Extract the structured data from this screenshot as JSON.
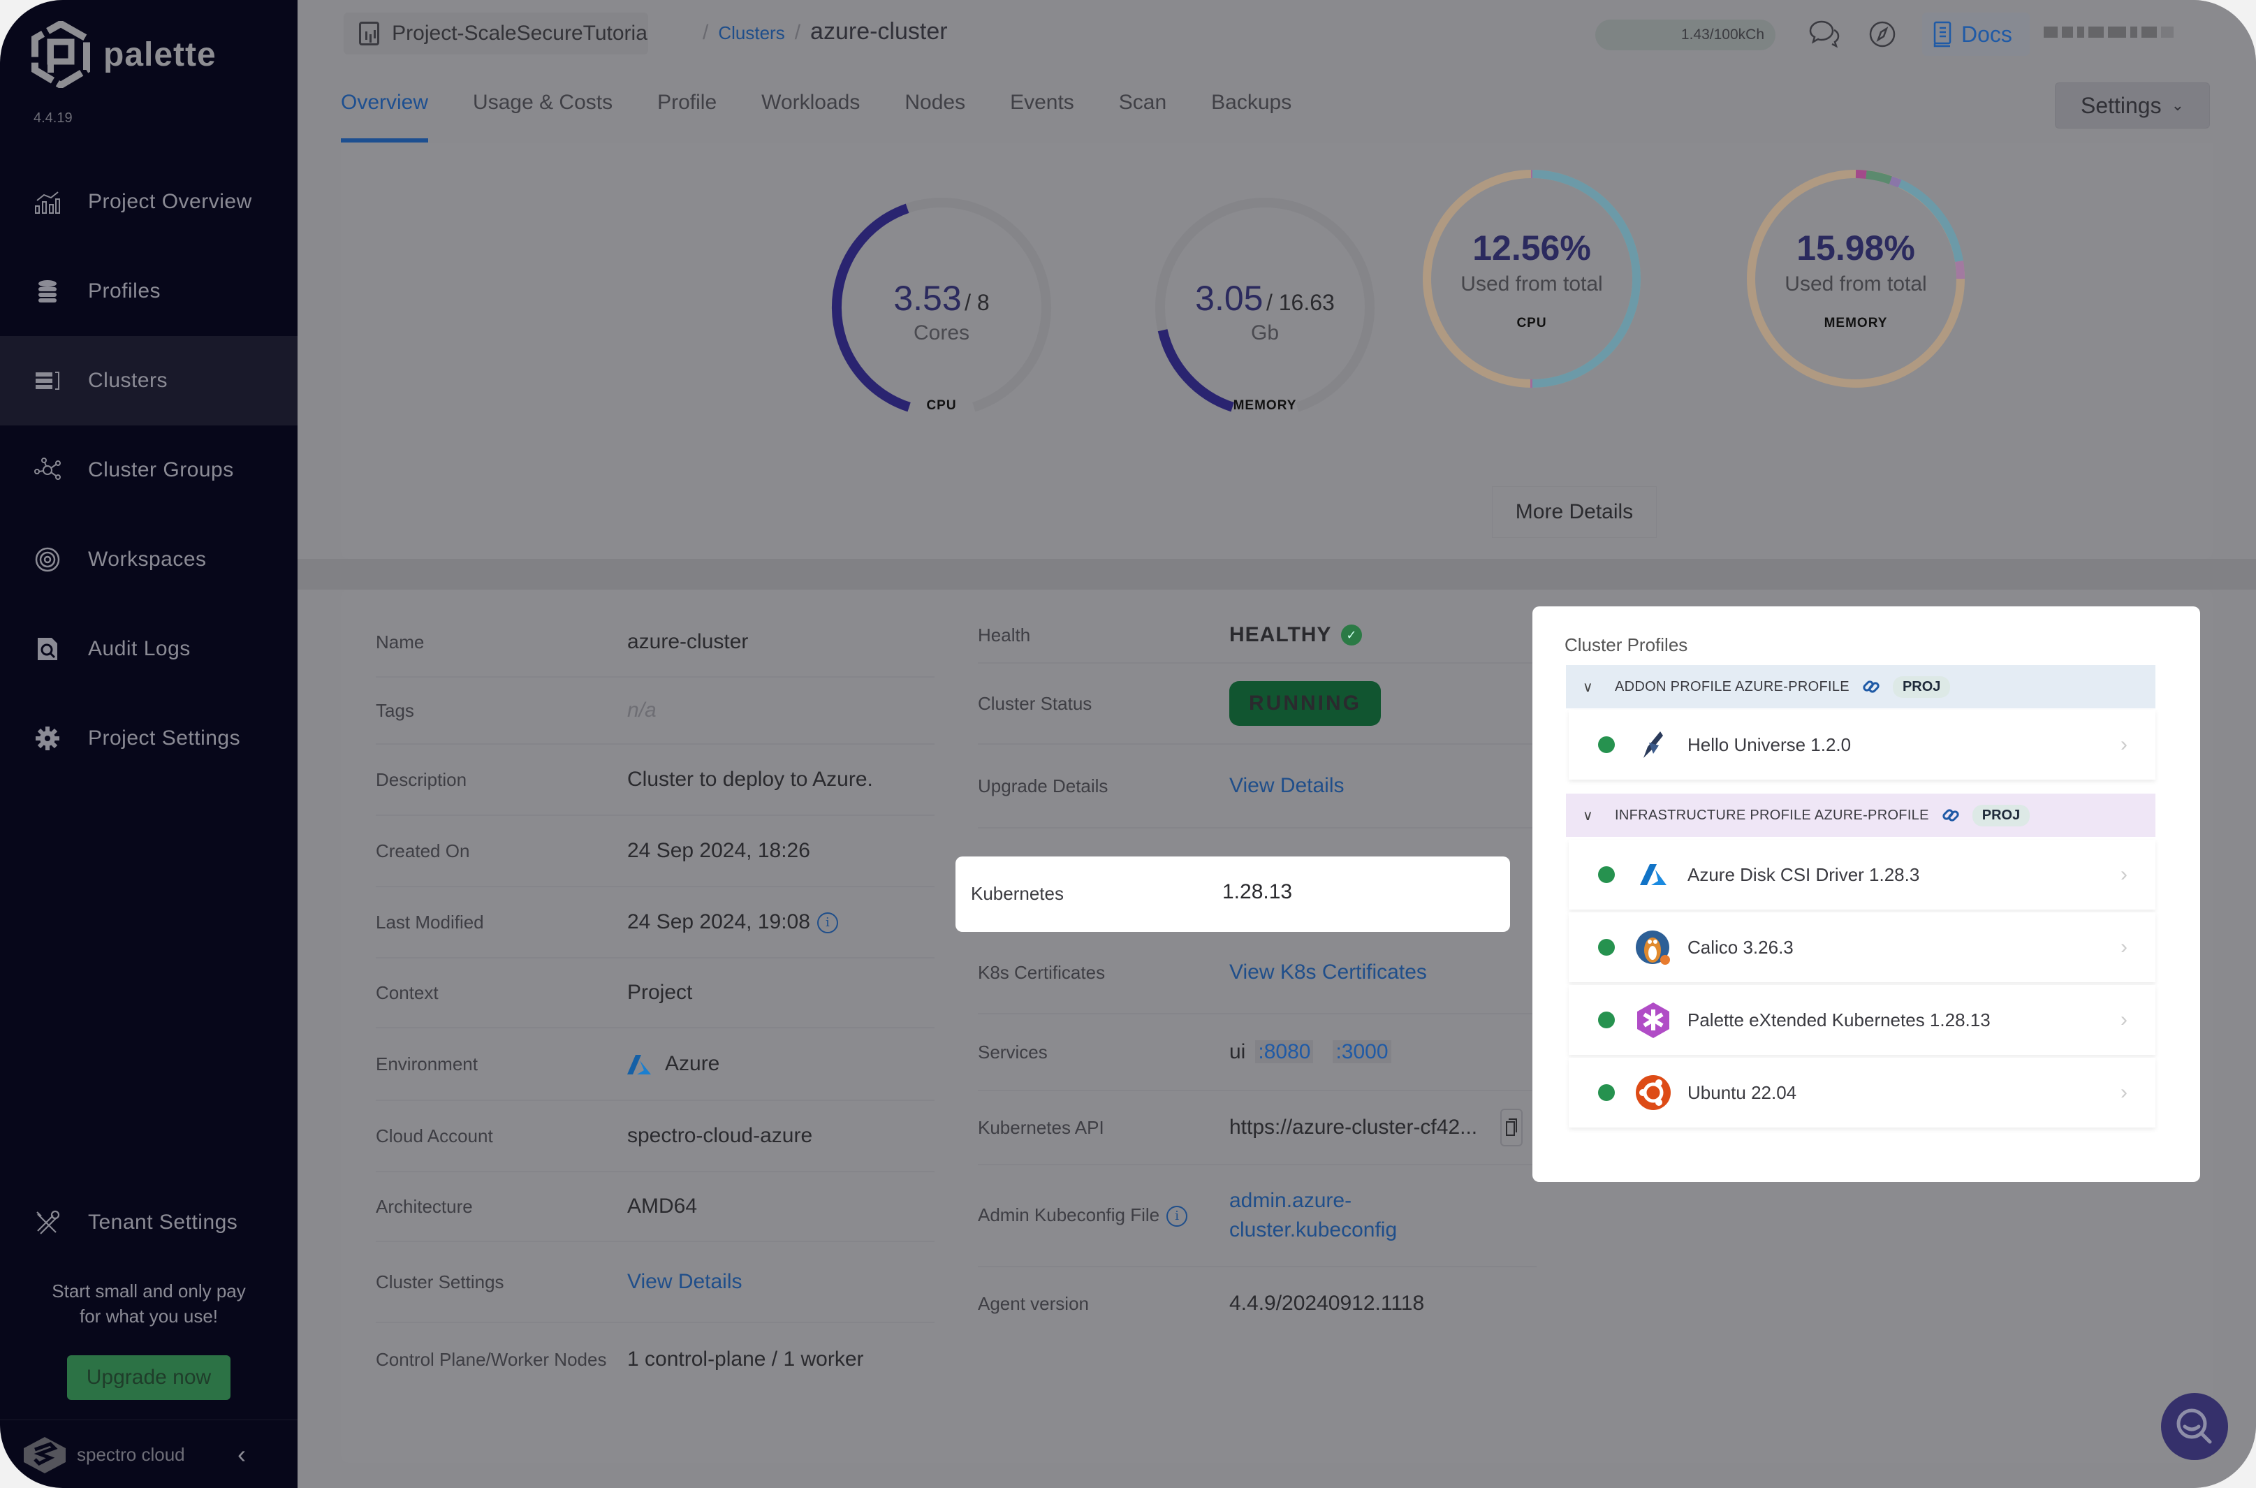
{
  "app": {
    "name": "palette",
    "version": "4.4.19"
  },
  "sidebar": {
    "items": [
      {
        "label": "Project Overview",
        "icon": "chart-overview-icon",
        "active": false
      },
      {
        "label": "Profiles",
        "icon": "database-stack-icon",
        "active": false
      },
      {
        "label": "Clusters",
        "icon": "server-rack-icon",
        "active": true
      },
      {
        "label": "Cluster Groups",
        "icon": "cluster-nodes-icon",
        "active": false
      },
      {
        "label": "Workspaces",
        "icon": "target-rings-icon",
        "active": false
      },
      {
        "label": "Audit Logs",
        "icon": "doc-search-icon",
        "active": false
      },
      {
        "label": "Project Settings",
        "icon": "gear-icon",
        "active": false
      }
    ],
    "tenant_settings": "Tenant Settings",
    "promo_line1": "Start small and only pay",
    "promo_line2": "for what you use!",
    "upgrade_label": "Upgrade now",
    "footer_brand": "spectro cloud"
  },
  "header": {
    "project": "Project-ScaleSecureTutoria",
    "breadcrumb_parent": "Clusters",
    "breadcrumb_current": "azure-cluster",
    "credits": "1.43/100kCh",
    "docs_label": "Docs"
  },
  "tabs": [
    {
      "label": "Overview",
      "active": true
    },
    {
      "label": "Usage & Costs",
      "active": false
    },
    {
      "label": "Profile",
      "active": false
    },
    {
      "label": "Workloads",
      "active": false
    },
    {
      "label": "Nodes",
      "active": false
    },
    {
      "label": "Events",
      "active": false
    },
    {
      "label": "Scan",
      "active": false
    },
    {
      "label": "Backups",
      "active": false
    }
  ],
  "settings_label": "Settings",
  "usage": {
    "cpu": {
      "value": "3.53",
      "total": "/ 8",
      "unit": "Cores",
      "label": "CPU",
      "used": 3.53,
      "max": 8
    },
    "memory": {
      "value": "3.05",
      "total": "/ 16.63",
      "unit": "Gb",
      "label": "MEMORY",
      "used": 3.05,
      "max": 16.63
    },
    "cpu_pct": {
      "percent": "12.56%",
      "sub": "Used from total",
      "label": "CPU"
    },
    "mem_pct": {
      "percent": "15.98%",
      "sub": "Used from total",
      "label": "MEMORY"
    },
    "more_details": "More Details",
    "colors": {
      "gauge_fill": "#2a2470",
      "gauge_track": "#858589",
      "donut_tan": "#b09a82",
      "donut_blue": "#6c9aa8",
      "donut_pink": "#a26a9a",
      "donut_green": "#5b8a6e",
      "donut_violet": "#8a76a8"
    }
  },
  "details": {
    "left": [
      {
        "label": "Name",
        "value": "azure-cluster"
      },
      {
        "label": "Tags",
        "value": "n/a"
      },
      {
        "label": "Description",
        "value": "Cluster to deploy to Azure."
      },
      {
        "label": "Created On",
        "value": "24 Sep 2024, 18:26"
      },
      {
        "label": "Last Modified",
        "value": "24 Sep 2024, 19:08"
      },
      {
        "label": "Context",
        "value": "Project"
      },
      {
        "label": "Environment",
        "value": "Azure"
      },
      {
        "label": "Cloud Account",
        "value": "spectro-cloud-azure"
      },
      {
        "label": "Architecture",
        "value": "AMD64"
      },
      {
        "label": "Cluster Settings",
        "value": "View Details"
      },
      {
        "label": "Control Plane/Worker Nodes",
        "value": "1 control-plane / 1 worker"
      }
    ],
    "right": {
      "health_label": "Health",
      "health_value": "HEALTHY",
      "status_label": "Cluster Status",
      "status_value": "RUNNING",
      "upgrade_label": "Upgrade Details",
      "upgrade_value": "View Details",
      "kubernetes_label": "Kubernetes",
      "kubernetes_value": "1.28.13",
      "certs_label": "K8s Certificates",
      "certs_value": "View K8s Certificates",
      "services_label": "Services",
      "services_name": "ui",
      "services_port1": ":8080",
      "services_port2": ":3000",
      "api_label": "Kubernetes API",
      "api_value": "https://azure-cluster-cf42...",
      "kubeconfig_label": "Admin Kubeconfig File",
      "kubeconfig_line1": "admin.azure-",
      "kubeconfig_line2": "cluster.kubeconfig",
      "agent_label": "Agent version",
      "agent_value": "4.4.9/20240912.1118"
    }
  },
  "profiles": {
    "title": "Cluster Profiles",
    "groups": [
      {
        "name": "ADDON PROFILE AZURE-PROFILE",
        "badge": "PROJ",
        "packs": [
          {
            "name": "Hello Universe 1.2.0",
            "icon": "hello-universe-icon"
          }
        ]
      },
      {
        "name": "INFRASTRUCTURE PROFILE AZURE-PROFILE",
        "badge": "PROJ",
        "packs": [
          {
            "name": "Azure Disk CSI Driver 1.28.3",
            "icon": "azure-icon"
          },
          {
            "name": "Calico 3.26.3",
            "icon": "calico-icon"
          },
          {
            "name": "Palette eXtended Kubernetes 1.28.13",
            "icon": "pxk-icon"
          },
          {
            "name": "Ubuntu 22.04",
            "icon": "ubuntu-icon"
          }
        ]
      }
    ]
  }
}
